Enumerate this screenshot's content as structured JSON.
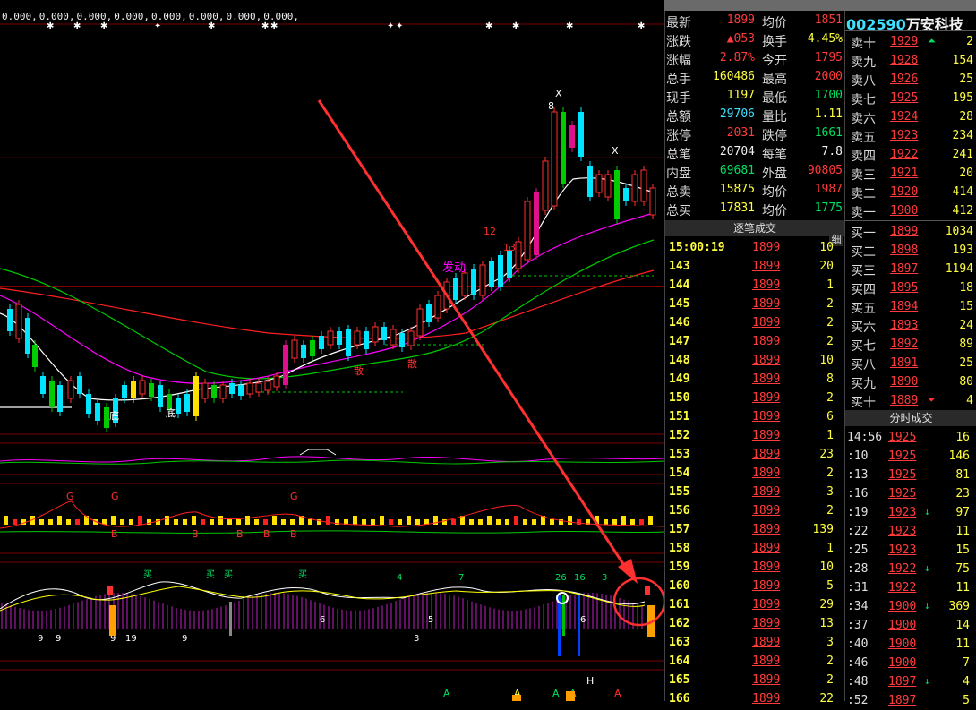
{
  "ma_legend": [
    "0.000,",
    "0.000,",
    "0.000,",
    "0.000,",
    "0.000,",
    "0.000,",
    "0.000,",
    "0.000,"
  ],
  "stock": {
    "code": "002590",
    "name": "万安科技"
  },
  "quote": [
    {
      "l1": "最新",
      "v1": "1899",
      "c1": "red",
      "l2": "均价",
      "v2": "1851",
      "c2": "red"
    },
    {
      "l1": "涨跌",
      "v1": "▲053",
      "c1": "red",
      "l2": "换手",
      "v2": "4.45%",
      "c2": "yellow"
    },
    {
      "l1": "涨幅",
      "v1": "2.87%",
      "c1": "red",
      "l2": "今开",
      "v2": "1795",
      "c2": "red"
    },
    {
      "l1": "总手",
      "v1": "160486",
      "c1": "yellow",
      "l2": "最高",
      "v2": "2000",
      "c2": "red"
    },
    {
      "l1": "现手",
      "v1": "1197",
      "c1": "yellow",
      "l2": "最低",
      "v2": "1700",
      "c2": "green"
    },
    {
      "l1": "总额",
      "v1": "29706",
      "c1": "cyan",
      "l2": "量比",
      "v2": "1.11",
      "c2": "yellow"
    },
    {
      "l1": "涨停",
      "v1": "2031",
      "c1": "red",
      "l2": "跌停",
      "v2": "1661",
      "c2": "green"
    },
    {
      "l1": "总笔",
      "v1": "20704",
      "c1": "white",
      "l2": "每笔",
      "v2": "7.8",
      "c2": "white"
    },
    {
      "l1": "内盘",
      "v1": "69681",
      "c1": "green",
      "l2": "外盘",
      "v2": "90805",
      "c2": "red"
    },
    {
      "l1": "总卖",
      "v1": "15875",
      "c1": "yellow",
      "l2": "均价",
      "v2": "1987",
      "c2": "red"
    },
    {
      "l1": "总买",
      "v1": "17831",
      "c1": "yellow",
      "l2": "均价",
      "v2": "1775",
      "c2": "green"
    }
  ],
  "ticks_header": "逐笔成交",
  "detail_label": "细",
  "ticks": [
    {
      "t": "15:00:19",
      "p": "1899",
      "v": "10"
    },
    {
      "t": "143",
      "p": "1899",
      "v": "20"
    },
    {
      "t": "144",
      "p": "1899",
      "v": "1"
    },
    {
      "t": "145",
      "p": "1899",
      "v": "2"
    },
    {
      "t": "146",
      "p": "1899",
      "v": "2"
    },
    {
      "t": "147",
      "p": "1899",
      "v": "2"
    },
    {
      "t": "148",
      "p": "1899",
      "v": "10"
    },
    {
      "t": "149",
      "p": "1899",
      "v": "8"
    },
    {
      "t": "150",
      "p": "1899",
      "v": "2"
    },
    {
      "t": "151",
      "p": "1899",
      "v": "6"
    },
    {
      "t": "152",
      "p": "1899",
      "v": "1"
    },
    {
      "t": "153",
      "p": "1899",
      "v": "23"
    },
    {
      "t": "154",
      "p": "1899",
      "v": "2"
    },
    {
      "t": "155",
      "p": "1899",
      "v": "3"
    },
    {
      "t": "156",
      "p": "1899",
      "v": "2"
    },
    {
      "t": "157",
      "p": "1899",
      "v": "139"
    },
    {
      "t": "158",
      "p": "1899",
      "v": "1"
    },
    {
      "t": "159",
      "p": "1899",
      "v": "10"
    },
    {
      "t": "160",
      "p": "1899",
      "v": "5"
    },
    {
      "t": "161",
      "p": "1899",
      "v": "29"
    },
    {
      "t": "162",
      "p": "1899",
      "v": "13"
    },
    {
      "t": "163",
      "p": "1899",
      "v": "3"
    },
    {
      "t": "164",
      "p": "1899",
      "v": "2"
    },
    {
      "t": "165",
      "p": "1899",
      "v": "2"
    },
    {
      "t": "166",
      "p": "1899",
      "v": "22"
    }
  ],
  "sells": [
    {
      "l": "卖十",
      "p": "1929",
      "v": "2",
      "arrow": "up"
    },
    {
      "l": "卖九",
      "p": "1928",
      "v": "154"
    },
    {
      "l": "卖八",
      "p": "1926",
      "v": "25"
    },
    {
      "l": "卖七",
      "p": "1925",
      "v": "195"
    },
    {
      "l": "卖六",
      "p": "1924",
      "v": "28"
    },
    {
      "l": "卖五",
      "p": "1923",
      "v": "234"
    },
    {
      "l": "卖四",
      "p": "1922",
      "v": "241"
    },
    {
      "l": "卖三",
      "p": "1921",
      "v": "20"
    },
    {
      "l": "卖二",
      "p": "1920",
      "v": "414"
    },
    {
      "l": "卖一",
      "p": "1900",
      "v": "412"
    }
  ],
  "buys": [
    {
      "l": "买一",
      "p": "1899",
      "v": "1034"
    },
    {
      "l": "买二",
      "p": "1898",
      "v": "193"
    },
    {
      "l": "买三",
      "p": "1897",
      "v": "1194"
    },
    {
      "l": "买四",
      "p": "1895",
      "v": "18"
    },
    {
      "l": "买五",
      "p": "1894",
      "v": "15"
    },
    {
      "l": "买六",
      "p": "1893",
      "v": "24"
    },
    {
      "l": "买七",
      "p": "1892",
      "v": "89"
    },
    {
      "l": "买八",
      "p": "1891",
      "v": "25"
    },
    {
      "l": "买九",
      "p": "1890",
      "v": "80"
    },
    {
      "l": "买十",
      "p": "1889",
      "v": "4",
      "arrow": "down"
    }
  ],
  "intraday_header": "分时成交",
  "intraday": [
    {
      "t": "14:56",
      "p": "1925",
      "v": "16"
    },
    {
      "t": ":10",
      "p": "1925",
      "v": "146"
    },
    {
      "t": ":13",
      "p": "1925",
      "v": "81"
    },
    {
      "t": ":16",
      "p": "1925",
      "v": "23"
    },
    {
      "t": ":19",
      "p": "1923",
      "v": "97",
      "arrow": "down"
    },
    {
      "t": ":22",
      "p": "1923",
      "v": "11"
    },
    {
      "t": ":25",
      "p": "1923",
      "v": "15"
    },
    {
      "t": ":28",
      "p": "1922",
      "v": "75",
      "arrow": "down"
    },
    {
      "t": ":31",
      "p": "1922",
      "v": "11"
    },
    {
      "t": ":34",
      "p": "1900",
      "v": "369",
      "arrow": "down"
    },
    {
      "t": ":37",
      "p": "1900",
      "v": "14"
    },
    {
      "t": ":40",
      "p": "1900",
      "v": "11"
    },
    {
      "t": ":46",
      "p": "1900",
      "v": "7"
    },
    {
      "t": ":48",
      "p": "1897",
      "v": "4",
      "arrow": "down"
    },
    {
      "t": ":52",
      "p": "1897",
      "v": "5"
    }
  ],
  "chart_labels": {
    "di1": "底",
    "di2": "底",
    "di3": "底",
    "san1": "散",
    "san2": "散",
    "fa": "发动",
    "c1": "12",
    "c2": "13",
    "c3": "8",
    "c4": "X",
    "c5": "X",
    "buy": "买",
    "n4": "4",
    "n7": "7",
    "n26": "26",
    "n16": "16",
    "n3": "3",
    "n3b": "3",
    "n19": "19",
    "n9": "9",
    "n9b": "9",
    "n9c": "9",
    "n6": "6",
    "n5": "5",
    "G": "G",
    "B": "B",
    "A": "A",
    "H": "H"
  },
  "colors": {
    "up": "#ff3030",
    "down": "#00e5ff",
    "bull": "#00cc00",
    "ma5": "#ffffff",
    "ma10": "#ff00ff",
    "ma20": "#00c800",
    "ma60": "#ff2020",
    "arrow": "#ff3030"
  }
}
